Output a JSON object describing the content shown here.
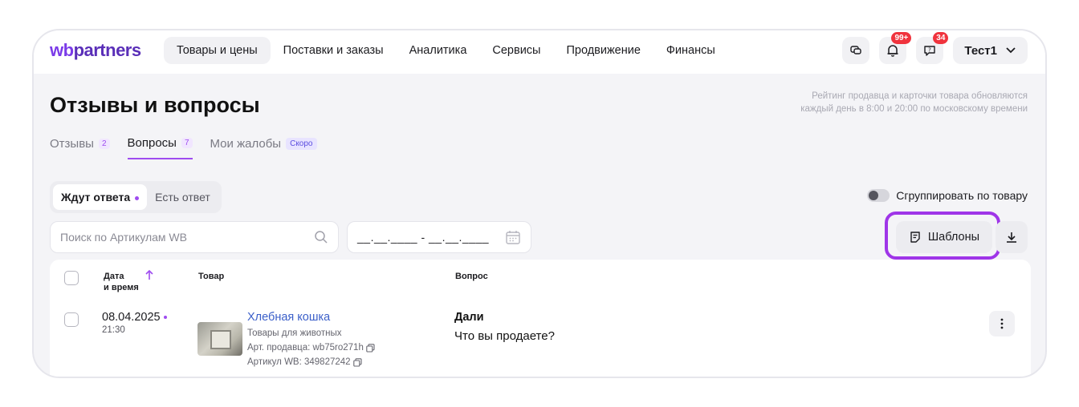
{
  "header": {
    "logo_wb": "wb",
    "logo_partners": "partners",
    "nav": [
      {
        "label": "Товары и цены",
        "active": true
      },
      {
        "label": "Поставки и заказы"
      },
      {
        "label": "Аналитика"
      },
      {
        "label": "Сервисы"
      },
      {
        "label": "Продвижение"
      },
      {
        "label": "Финансы"
      }
    ],
    "notifications_badge": "99+",
    "messages_badge": "34",
    "user_name": "Тест1"
  },
  "page": {
    "title": "Отзывы и вопросы",
    "rating_note_line1": "Рейтинг продавца и карточки товара обновляются",
    "rating_note_line2": "каждый день в 8:00 и 20:00 по московскому времени"
  },
  "tabs": [
    {
      "label": "Отзывы",
      "count": "2"
    },
    {
      "label": "Вопросы",
      "count": "7",
      "active": true
    },
    {
      "label": "Мои жалобы",
      "tag": "Скоро"
    }
  ],
  "filters": {
    "segment_waiting": "Ждут ответа",
    "segment_answered": "Есть ответ",
    "group_toggle_label": "Сгруппировать по товару",
    "search_placeholder": "Поиск по Артикулам WB",
    "date_range": "__.__.____ - __.__.____",
    "templates_label": "Шаблоны"
  },
  "table": {
    "columns": {
      "date_line1": "Дата",
      "date_line2": "и время",
      "product": "Товар",
      "question": "Вопрос"
    },
    "rows": [
      {
        "date": "08.04.2025",
        "time": "21:30",
        "product_name": "Хлебная кошка",
        "category": "Товары для животных",
        "seller_article": "Арт. продавца: wb75ro271h",
        "wb_article": "Артикул WB: 349827242",
        "author": "Дали",
        "question": "Что вы продаете?"
      }
    ]
  },
  "colors": {
    "accent": "#9f4cf0",
    "highlight_outline": "#9f35e8",
    "badge": "#f0333d",
    "link": "#3b5fc9"
  }
}
